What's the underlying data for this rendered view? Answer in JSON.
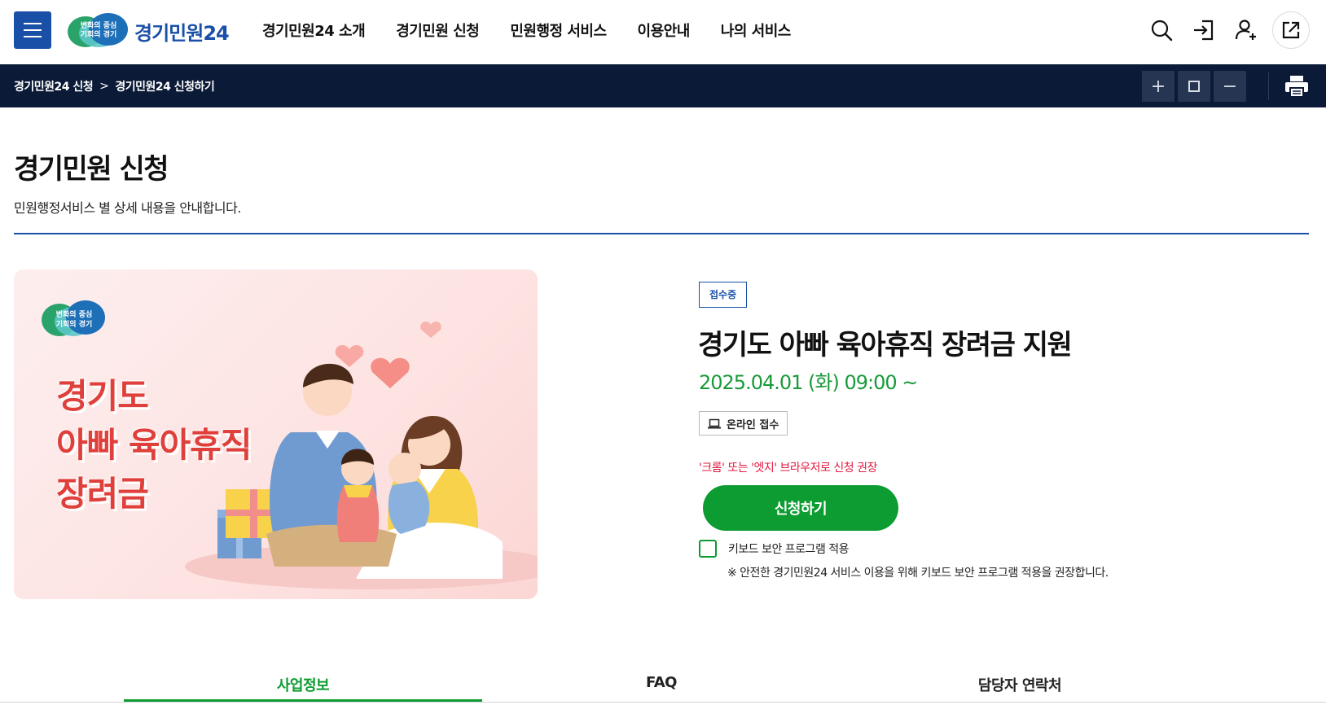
{
  "header": {
    "logo_badge_line1": "변화의 중심",
    "logo_badge_line2": "기회의 경기",
    "logo_text": "경기민원24",
    "nav": [
      {
        "label": "경기민원24 소개"
      },
      {
        "label": "경기민원 신청"
      },
      {
        "label": "민원행정 서비스"
      },
      {
        "label": "이용안내"
      },
      {
        "label": "나의 서비스"
      }
    ],
    "utility_icons": [
      "search-icon",
      "login-icon",
      "user-add-icon",
      "external-link-icon"
    ]
  },
  "breadcrumb": {
    "items": [
      "경기민원24 신청",
      "경기민원24 신청하기"
    ],
    "separator": ">",
    "zoom_controls": [
      "zoom-in-icon",
      "zoom-reset-icon",
      "zoom-out-icon"
    ],
    "print_icon": "print-icon"
  },
  "page": {
    "title": "경기민원 신청",
    "description": "민원행정서비스 별 상세 내용을 안내합니다."
  },
  "banner": {
    "logo_line1": "변화의 중심",
    "logo_line2": "기회의 경기",
    "lines": [
      "경기도",
      "아빠 육아휴직",
      "장려금"
    ]
  },
  "service": {
    "status": "접수중",
    "title": "경기도 아빠 육아휴직 장려금 지원",
    "date": "2025.04.01 (화) 09:00 ~",
    "channel": "온라인 접수",
    "browser_note": "'크롬' 또는 '엣지' 브라우저로 신청 권장",
    "apply_label": "신청하기",
    "keyboard_security_label": "키보드 보안 프로그램 적용",
    "keyboard_security_checked": false,
    "keyboard_security_note": "※ 안전한 경기민원24 서비스 이용을 위해 키보드 보안 프로그램 적용을 권장합니다."
  },
  "tabs": [
    {
      "label": "사업정보",
      "active": true
    },
    {
      "label": "FAQ",
      "active": false
    },
    {
      "label": "담당자 연락처",
      "active": false
    }
  ],
  "colors": {
    "primary_blue": "#1a4fa8",
    "dark_navy": "#0b1a36",
    "green": "#0d9c31",
    "date_green": "#199a3a",
    "red_note": "#e3193f",
    "banner_red": "#e0403b"
  }
}
